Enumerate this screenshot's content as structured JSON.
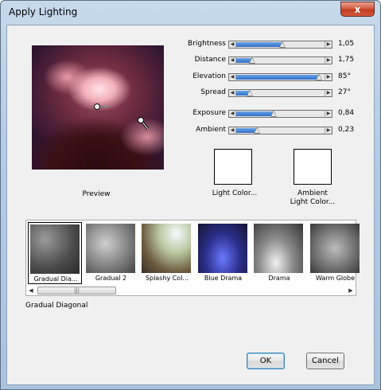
{
  "window": {
    "title": "Apply Lighting",
    "close_glyph": "x"
  },
  "preview": {
    "label": "Preview"
  },
  "sliders": [
    {
      "label": "Brightness",
      "value": "1,05",
      "fraction": 0.52
    },
    {
      "label": "Distance",
      "value": "1,75",
      "fraction": 0.18
    },
    {
      "label": "Elevation",
      "value": "85°",
      "fraction": 0.94
    },
    {
      "label": "Spread",
      "value": "27°",
      "fraction": 0.15
    },
    {
      "label": "Exposure",
      "value": "0,84",
      "fraction": 0.42
    },
    {
      "label": "Ambient",
      "value": "0,23",
      "fraction": 0.23
    }
  ],
  "swatches": {
    "light_color": {
      "label": "Light Color...",
      "color": "#ffffff"
    },
    "ambient_color": {
      "line1": "Ambient",
      "line2": "Light Color...",
      "color": "#ffffff"
    }
  },
  "gallery": {
    "items": [
      {
        "caption": "Gradual Dia...",
        "selected": true
      },
      {
        "caption": "Gradual 2",
        "selected": false
      },
      {
        "caption": "Splashy Col...",
        "selected": false
      },
      {
        "caption": "Blue Drama",
        "selected": false
      },
      {
        "caption": "Drama",
        "selected": false
      },
      {
        "caption": "Warm Globe",
        "selected": false
      }
    ],
    "selected_name": "Gradual Diagonal"
  },
  "buttons": {
    "ok": "OK",
    "cancel": "Cancel"
  },
  "colors": {
    "slider_fill": "#3a7bd5",
    "titlebar": "#b9cfe7",
    "close": "#c9442a"
  }
}
